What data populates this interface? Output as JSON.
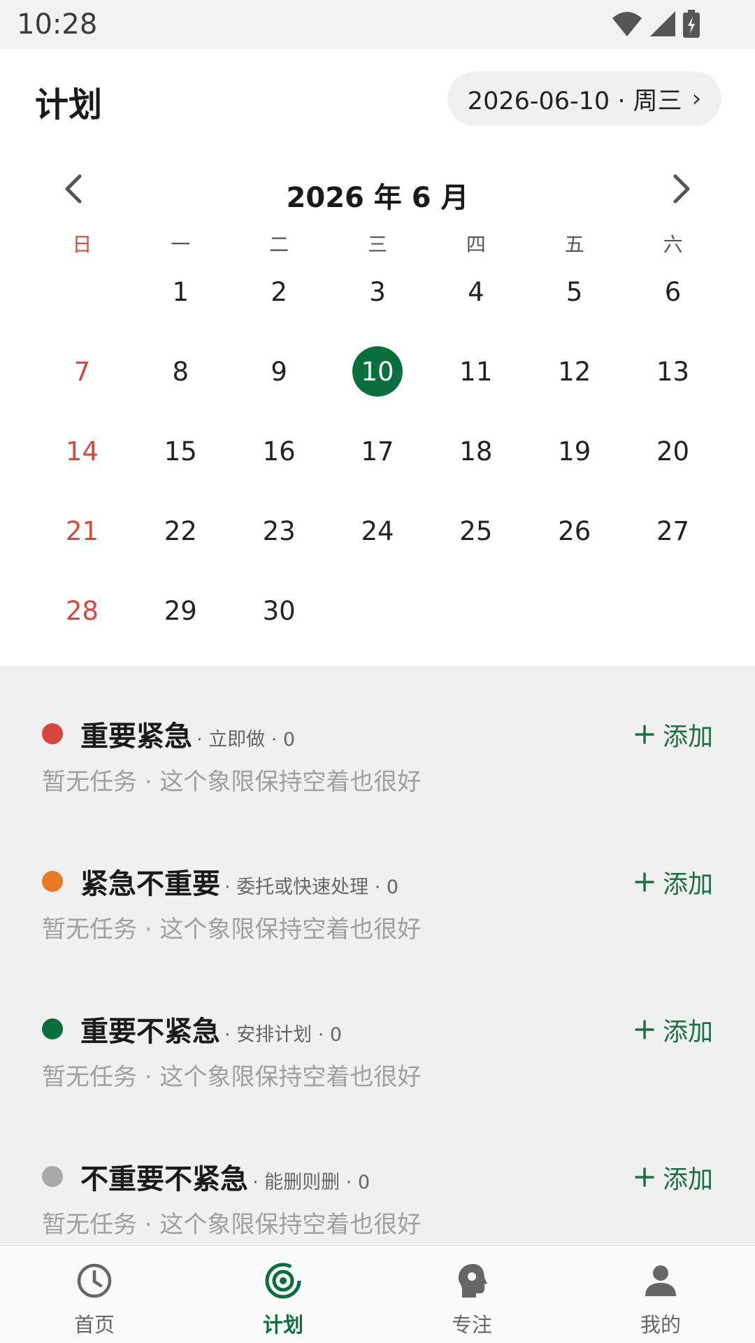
{
  "status_bar": {
    "time": "10:28"
  },
  "header": {
    "title": "计划",
    "date_pill": "2026-06-10 · 周三",
    "date_chevron": "›"
  },
  "calendar": {
    "month_title": "2026 年 6 月",
    "weekdays": [
      "日",
      "一",
      "二",
      "三",
      "四",
      "五",
      "六"
    ],
    "leading_blanks": 1,
    "days": [
      "1",
      "2",
      "3",
      "4",
      "5",
      "6",
      "7",
      "8",
      "9",
      "10",
      "11",
      "12",
      "13",
      "14",
      "15",
      "16",
      "17",
      "18",
      "19",
      "20",
      "21",
      "22",
      "23",
      "24",
      "25",
      "26",
      "27",
      "28",
      "29",
      "30"
    ],
    "selected_day": "10"
  },
  "quadrants": [
    {
      "title": "重要紧急",
      "subtitle": "· 立即做 · 0",
      "add_label": "添加",
      "empty_text": "暂无任务 · 这个象限保持空着也很好",
      "dot_color": "#d9443e"
    },
    {
      "title": "紧急不重要",
      "subtitle": "· 委托或快速处理 · 0",
      "add_label": "添加",
      "empty_text": "暂无任务 · 这个象限保持空着也很好",
      "dot_color": "#e87a23"
    },
    {
      "title": "重要不紧急",
      "subtitle": "· 安排计划 · 0",
      "add_label": "添加",
      "empty_text": "暂无任务 · 这个象限保持空着也很好",
      "dot_color": "#0b6e3f"
    },
    {
      "title": "不重要不紧急",
      "subtitle": "· 能删则删 · 0",
      "add_label": "添加",
      "empty_text": "暂无任务 · 这个象限保持空着也很好",
      "dot_color": "#a8a8a8"
    }
  ],
  "bottom_nav": [
    {
      "label": "首页",
      "icon": "clock-icon"
    },
    {
      "label": "计划",
      "icon": "target-icon",
      "active": true
    },
    {
      "label": "专注",
      "icon": "brain-head-icon"
    },
    {
      "label": "我的",
      "icon": "person-icon"
    }
  ],
  "colors": {
    "accent": "#0b6e3f",
    "sunday": "#d04a42",
    "add": "#1c6e46"
  }
}
